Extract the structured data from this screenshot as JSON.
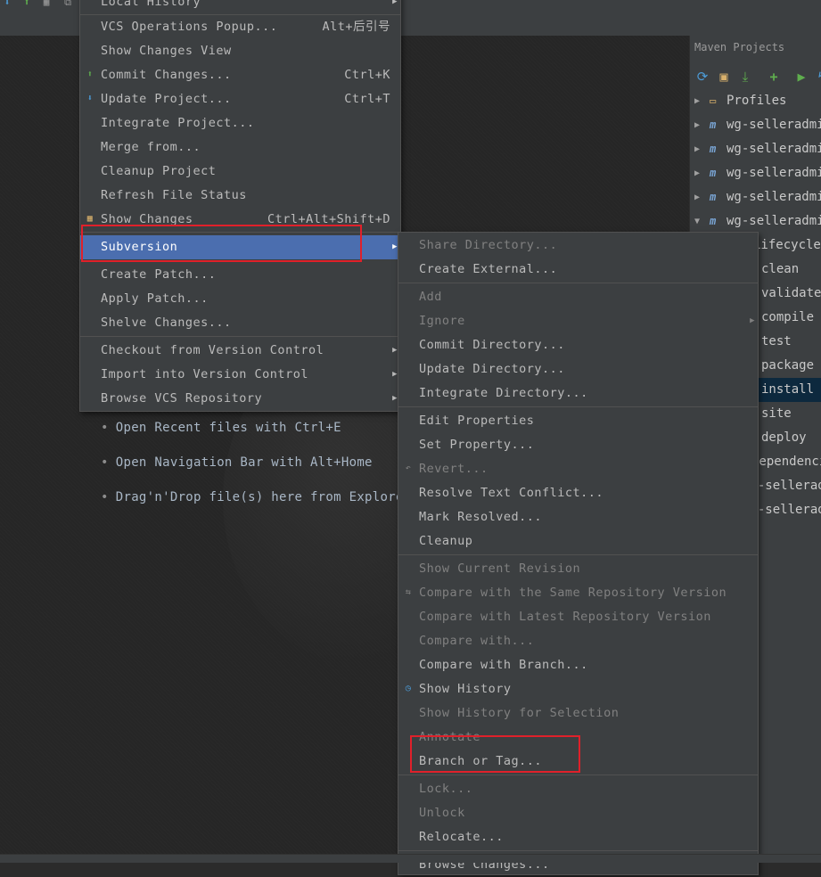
{
  "vcs_menu": {
    "items": [
      {
        "label": "Local History",
        "shortcut": "",
        "submenu": true,
        "disabled": false,
        "icon": ""
      },
      {
        "label": "VCS Operations Popup...",
        "shortcut": "Alt+后引号",
        "submenu": false,
        "icon": ""
      },
      {
        "label": "Show Changes View",
        "shortcut": "",
        "submenu": false,
        "icon": ""
      },
      {
        "label": "Commit Changes...",
        "shortcut": "Ctrl+K",
        "submenu": false,
        "icon": "vcs-commit-icon"
      },
      {
        "label": "Update Project...",
        "shortcut": "Ctrl+T",
        "submenu": false,
        "icon": "vcs-update-icon"
      },
      {
        "label": "Integrate Project...",
        "shortcut": "",
        "submenu": false,
        "icon": ""
      },
      {
        "label": "Merge from...",
        "shortcut": "",
        "submenu": false,
        "icon": ""
      },
      {
        "label": "Cleanup Project",
        "shortcut": "",
        "submenu": false,
        "icon": ""
      },
      {
        "label": "Refresh File Status",
        "shortcut": "",
        "submenu": false,
        "icon": ""
      },
      {
        "label": "Show Changes",
        "shortcut": "Ctrl+Alt+Shift+D",
        "submenu": false,
        "icon": "show-changes-icon"
      },
      {
        "label": "Subversion",
        "shortcut": "",
        "submenu": true,
        "highlighted": true,
        "icon": ""
      },
      {
        "label": "Create Patch...",
        "shortcut": "",
        "submenu": false,
        "icon": ""
      },
      {
        "label": "Apply Patch...",
        "shortcut": "",
        "submenu": false,
        "icon": ""
      },
      {
        "label": "Shelve Changes...",
        "shortcut": "",
        "submenu": false,
        "icon": ""
      },
      {
        "label": "Checkout from Version Control",
        "shortcut": "",
        "submenu": true,
        "icon": ""
      },
      {
        "label": "Import into Version Control",
        "shortcut": "",
        "submenu": true,
        "icon": ""
      },
      {
        "label": "Browse VCS Repository",
        "shortcut": "",
        "submenu": true,
        "icon": ""
      }
    ]
  },
  "subversion_menu": {
    "items": [
      {
        "label": "Share Directory...",
        "disabled": true
      },
      {
        "label": "Create External...",
        "disabled": false
      },
      {
        "label": "Add",
        "disabled": true
      },
      {
        "label": "Ignore",
        "disabled": true,
        "submenu": true
      },
      {
        "label": "Commit Directory...",
        "disabled": false
      },
      {
        "label": "Update Directory...",
        "disabled": false
      },
      {
        "label": "Integrate Directory...",
        "disabled": false
      },
      {
        "label": "Edit Properties",
        "disabled": false
      },
      {
        "label": "Set Property...",
        "disabled": false
      },
      {
        "label": "Revert...",
        "disabled": true,
        "icon": "revert-icon"
      },
      {
        "label": "Resolve Text Conflict...",
        "disabled": false
      },
      {
        "label": "Mark Resolved...",
        "disabled": false
      },
      {
        "label": "Cleanup",
        "disabled": false
      },
      {
        "label": "Show Current Revision",
        "disabled": true
      },
      {
        "label": "Compare with the Same Repository Version",
        "disabled": true,
        "icon": "compare-icon"
      },
      {
        "label": "Compare with Latest Repository Version",
        "disabled": true
      },
      {
        "label": "Compare with...",
        "disabled": true
      },
      {
        "label": "Compare with Branch...",
        "disabled": false
      },
      {
        "label": "Show History",
        "disabled": false,
        "icon": "history-icon"
      },
      {
        "label": "Show History for Selection",
        "disabled": true
      },
      {
        "label": "Annotate",
        "disabled": true
      },
      {
        "label": "Branch or Tag...",
        "disabled": false
      },
      {
        "label": "Lock...",
        "disabled": true
      },
      {
        "label": "Unlock",
        "disabled": true
      },
      {
        "label": "Relocate...",
        "disabled": false
      },
      {
        "label": "Browse Changes...",
        "disabled": false
      }
    ]
  },
  "editor_hints": [
    "Open Recent files with Ctrl+E",
    "Open Navigation Bar with Alt+Home",
    "Drag'n'Drop file(s) here from Explorer"
  ],
  "maven": {
    "title": "Maven Projects",
    "toolbar_icons": [
      "reimport-icon",
      "generate-sources-icon",
      "download-icon",
      "add-icon",
      "run-icon",
      "execute-goal-icon"
    ],
    "tree": [
      {
        "label": "Profiles",
        "expanded": false,
        "icon": "profiles-folder-icon"
      },
      {
        "label": "wg-selleradmin",
        "expanded": false,
        "icon": "maven-module-icon"
      },
      {
        "label": "wg-selleradmin",
        "expanded": false,
        "icon": "maven-module-icon"
      },
      {
        "label": "wg-selleradmin",
        "expanded": false,
        "icon": "maven-module-icon"
      },
      {
        "label": "wg-selleradmin",
        "expanded": false,
        "icon": "maven-module-icon"
      },
      {
        "label": "wg-selleradmin",
        "expanded": true,
        "icon": "maven-module-icon"
      }
    ],
    "lifecycle": [
      "Lifecycle",
      "clean",
      "validate",
      "compile",
      "test",
      "package",
      "install",
      "site",
      "deploy",
      "Dependencies",
      "wg-selleradmin",
      "wg-selleradmin"
    ],
    "selected": "install"
  },
  "colors": {
    "menu_bg": "#3c3f41",
    "highlight": "#4b6eaf",
    "annotation_red": "#e0202a",
    "editor_bg": "#262626"
  }
}
